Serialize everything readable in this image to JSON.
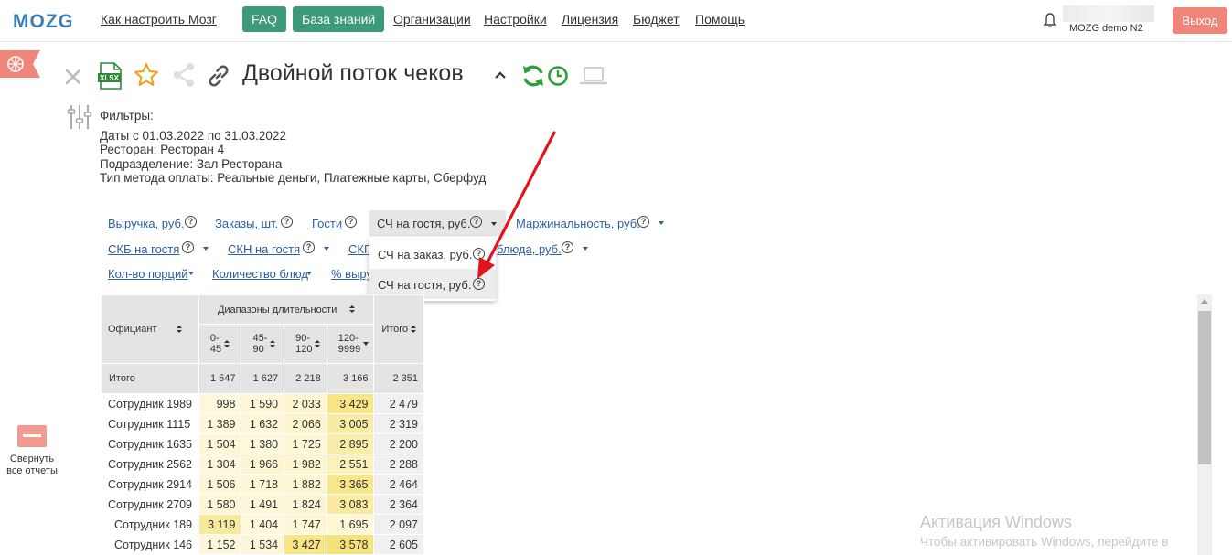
{
  "logo": {
    "text": "MOZG"
  },
  "nav": {
    "links": [
      "Как настроить Мозг",
      "Организации",
      "Настройки",
      "Лицензия",
      "Бюджет",
      "Помощь"
    ],
    "faq": "FAQ",
    "knowledge": "База знаний",
    "user": "MOZG demo N2",
    "logout": "Выход"
  },
  "sidebar": {
    "collapse_label_1": "Свернуть",
    "collapse_label_2": "все отчеты"
  },
  "report": {
    "title": "Двойной поток чеков"
  },
  "filters": {
    "heading": "Фильтры:",
    "dates_label": "Даты",
    "dates_value": " с 01.03.2022 по 31.03.2022",
    "restaurant_label": "Ресторан:",
    "restaurant_value": " Ресторан 4",
    "division_label": "Подразделение:",
    "division_value": " Зал Ресторана",
    "payment_label": "Тип метода оплаты:",
    "payment_value": " Реальные деньги, Платежные карты, Сберфуд"
  },
  "metrics": {
    "row1": [
      "Выручка, руб.",
      "Заказы, шт.",
      "Гости",
      "СЧ на гостя, руб.",
      "Маржинальность, руб."
    ],
    "row2": [
      "СКБ на гостя",
      "СКН на гостя",
      "СКП",
      "блюда, руб."
    ],
    "row3": [
      "Кол-во порций",
      "Количество блюд",
      "% выру"
    ]
  },
  "dropdown": {
    "items": [
      "СЧ на заказ, руб.",
      "СЧ на гостя, руб."
    ]
  },
  "table": {
    "col_waiter": "Официант",
    "col_group": "Диапазоны длительности",
    "ranges": [
      [
        "0-",
        "45"
      ],
      [
        "45-",
        "90"
      ],
      [
        "90-",
        "120"
      ],
      [
        "120-",
        "9999"
      ]
    ],
    "col_total": "Итого",
    "total_row": {
      "name": "Итого",
      "values": [
        "1 547",
        "1 627",
        "2 218",
        "3 166"
      ],
      "total": "2 351"
    },
    "rows": [
      {
        "name": "Сотрудник 1989",
        "values": [
          "998",
          "1 590",
          "2 033",
          "3 429"
        ],
        "total": "2 479",
        "indent": false
      },
      {
        "name": "Сотрудник 1115",
        "values": [
          "1 389",
          "1 632",
          "2 066",
          "3 005"
        ],
        "total": "2 319",
        "indent": false
      },
      {
        "name": "Сотрудник 1635",
        "values": [
          "1 504",
          "1 380",
          "1 725",
          "2 895"
        ],
        "total": "2 200",
        "indent": false
      },
      {
        "name": "Сотрудник 2562",
        "values": [
          "1 304",
          "1 966",
          "1 982",
          "2 551"
        ],
        "total": "2 288",
        "indent": false
      },
      {
        "name": "Сотрудник 2914",
        "values": [
          "1 506",
          "1 718",
          "1 882",
          "3 365"
        ],
        "total": "2 464",
        "indent": false
      },
      {
        "name": "Сотрудник 2709",
        "values": [
          "1 580",
          "1 491",
          "1 824",
          "3 083"
        ],
        "total": "2 364",
        "indent": false
      },
      {
        "name": "Сотрудник 189",
        "values": [
          "3 119",
          "1 404",
          "1 747",
          "1 695"
        ],
        "total": "2 097",
        "indent": true
      },
      {
        "name": "Сотрудник 146",
        "values": [
          "1 152",
          "1 534",
          "3 427",
          "3 578"
        ],
        "total": "2 605",
        "indent": true
      }
    ]
  },
  "watermark": {
    "line1": "Активация Windows",
    "line2": "Чтобы активировать Windows, перейдите в"
  },
  "colors": {
    "green": "#3c9a7a",
    "logout": "#f0857a",
    "link": "#2f5f9e",
    "heat_max": "#f6e27a",
    "heat_min": "#fdf8dc"
  }
}
